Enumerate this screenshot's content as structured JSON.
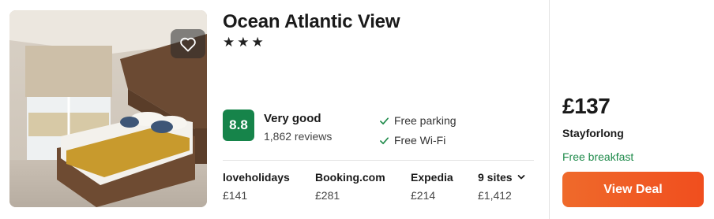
{
  "hotel": {
    "name": "Ocean Atlantic View",
    "stars": "★★★",
    "favorite_icon": "heart-outline-icon"
  },
  "rating": {
    "score": "8.8",
    "label": "Very good",
    "reviews": "1,862 reviews",
    "badge_color": "#16844a"
  },
  "amenities": [
    {
      "label": "Free parking",
      "icon": "check-icon"
    },
    {
      "label": "Free Wi-Fi",
      "icon": "check-icon"
    }
  ],
  "sites": [
    {
      "name": "loveholidays",
      "price": "£141"
    },
    {
      "name": "Booking.com",
      "price": "£281"
    },
    {
      "name": "Expedia",
      "price": "£214"
    },
    {
      "name": "9 sites",
      "price": "£1,412",
      "icon": "chevron-down-icon"
    }
  ],
  "best_deal": {
    "price": "£137",
    "provider": "Stayforlong",
    "perk": "Free breakfast",
    "perk_color": "#1e8a4a",
    "button_label": "View Deal",
    "button_color": "#f05a24"
  }
}
